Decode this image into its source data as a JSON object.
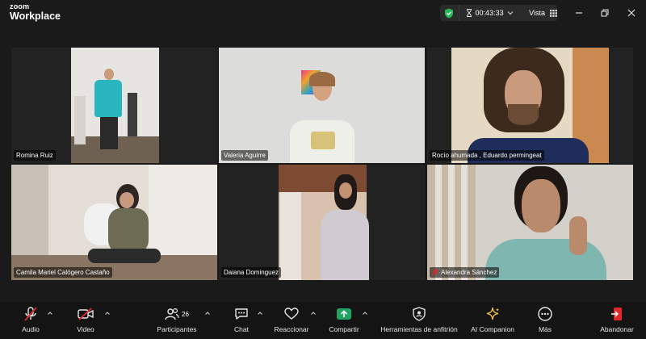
{
  "app": {
    "logo_top": "zoom",
    "logo_bottom": "Workplace"
  },
  "status": {
    "timer": "00:43:33",
    "view_label": "Vista"
  },
  "participants": [
    {
      "name": "Romina Ruiz"
    },
    {
      "name": "Valeria Aguirre"
    },
    {
      "name": "Rocío ahumada , Eduardo permingeat"
    },
    {
      "name": "Camila Mariel Calógero Castaño"
    },
    {
      "name": "Daiana Dominguez"
    },
    {
      "name": "Alexandra Sánchez",
      "muted": true
    }
  ],
  "toolbar": {
    "audio": "Audio",
    "video": "Video",
    "participants": "Participantes",
    "participants_count": "26",
    "chat": "Chat",
    "react": "Reaccionar",
    "share": "Compartir",
    "host_tools": "Herramientas de anfitrión",
    "ai_companion": "AI Companion",
    "more": "Más",
    "leave": "Abandonar"
  },
  "colors": {
    "accent_share": "#1ea362",
    "mute_red": "#e02828",
    "shield_green": "#27b85a",
    "ai_yellow": "#f2c443"
  }
}
